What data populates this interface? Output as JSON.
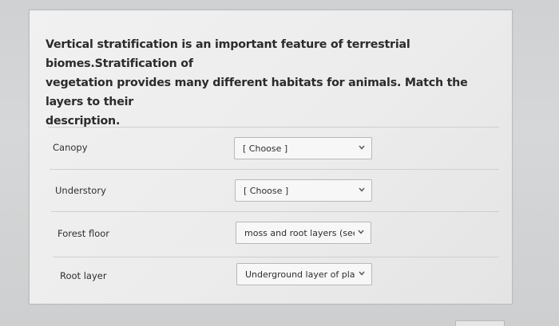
{
  "question": {
    "line1": "Vertical stratification is an important feature of terrestrial biomes.Stratification of",
    "line2": "vegetation provides many different habitats for animals. Match the layers to their",
    "line3": "description."
  },
  "rows": [
    {
      "term": "Canopy",
      "selected": "[ Choose ]"
    },
    {
      "term": "Understory",
      "selected": "[ Choose ]"
    },
    {
      "term": "Forest floor",
      "selected": "moss and root layers (see belc"
    },
    {
      "term": "Root layer",
      "selected": "Underground layer of plant ha"
    }
  ],
  "icons": {
    "dropdown": "chevron-down-icon"
  }
}
